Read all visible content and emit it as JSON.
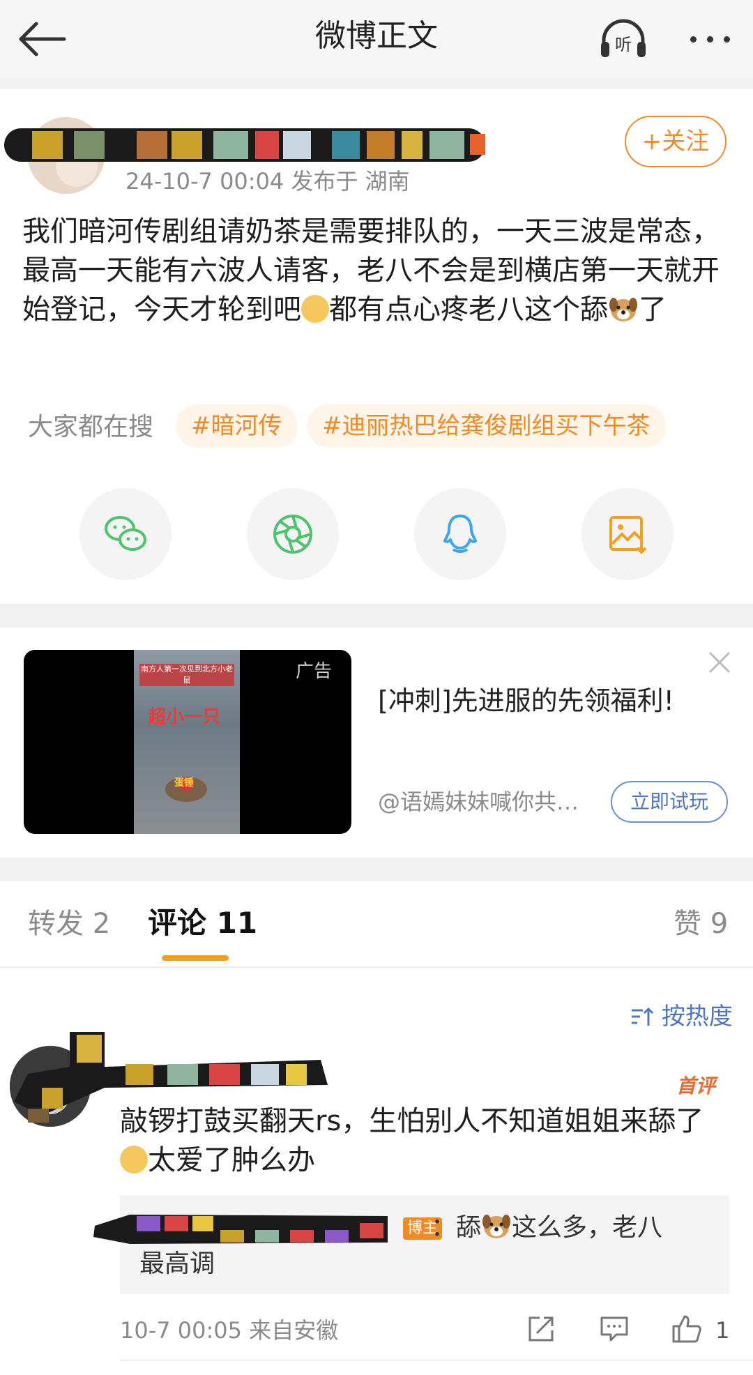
{
  "header": {
    "title": "微博正文",
    "listen_label": "听"
  },
  "post": {
    "meta": "24-10-7 00:04  发布于 湖南",
    "follow_label": "+关注",
    "text_part1": "我们暗河传剧组请奶茶是需要排队的，一天三波是常态，最高一天能有六波人请客，老八不会是到横店第一天就开始登记，今天才轮到吧",
    "text_part2": "都有点心疼老八这个舔",
    "text_part3": "了"
  },
  "trending": {
    "label": "大家都在搜",
    "tags": [
      "#暗河传",
      "#迪丽热巴给龚俊剧组买下午茶"
    ]
  },
  "share": {
    "icons": [
      "wechat-icon",
      "moments-icon",
      "qq-icon",
      "save-image-icon"
    ]
  },
  "ad": {
    "tag": "广告",
    "title": "[冲刺]先进服的先领福利!",
    "author": "@语嫣妹妹喊你共…",
    "button": "立即试玩",
    "thumb_caption_1": "南方人第一次见到北方小老鼠",
    "thumb_caption_2": "超小一只",
    "thumb_caption_3": "蛋锤"
  },
  "tabs": {
    "repost": "转发 2",
    "comment": "评论 11",
    "like": "赞 9"
  },
  "sort_label": "按热度",
  "comment": {
    "badge": "首评",
    "text_part1": "敲锣打鼓买翻天rs，生怕别人不知道姐姐来舔了",
    "text_part2": "太爱了肿么办",
    "reply_badge": "博主",
    "reply_part1": "：舔",
    "reply_part2": "这么多，老八",
    "reply_line2": "最高调",
    "meta": "10-7 00:05  来自安徽",
    "like_count": "1"
  },
  "colors": {
    "accent": "#f28c28",
    "link": "#4f77bd"
  }
}
